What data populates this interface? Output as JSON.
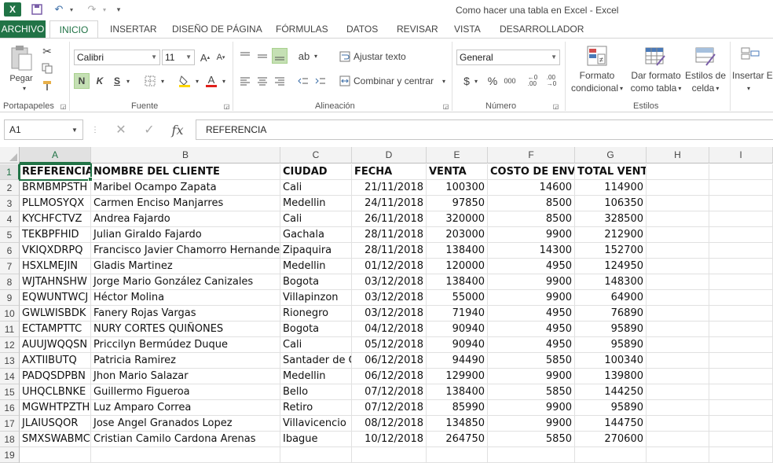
{
  "window": {
    "title": "Como hacer una tabla en Excel - Excel"
  },
  "tabs": [
    "ARCHIVO",
    "INICIO",
    "INSERTAR",
    "DISEÑO DE PÁGINA",
    "FÓRMULAS",
    "DATOS",
    "REVISAR",
    "VISTA",
    "DESARROLLADOR"
  ],
  "ribbon": {
    "paste_label": "Pegar",
    "font_name": "Calibri",
    "font_size": "11",
    "bold": "N",
    "italic": "K",
    "underline": "S",
    "wrap_text": "Ajustar texto",
    "merge_center": "Combinar y centrar",
    "number_format": "General",
    "currency": "$",
    "percent": "%",
    "thousands": "000",
    "cond_format_1": "Formato",
    "cond_format_2": "condicional",
    "format_table_1": "Dar formato",
    "format_table_2": "como tabla",
    "cell_styles_1": "Estilos de",
    "cell_styles_2": "celda",
    "insert": "Insertar",
    "insert_trunc": "E",
    "groups": {
      "clipboard": "Portapapeles",
      "font": "Fuente",
      "alignment": "Alineación",
      "number": "Número",
      "styles": "Estilos"
    }
  },
  "formula_bar": {
    "name_box": "A1",
    "fx": "fx",
    "content": "REFERENCIA"
  },
  "columns": [
    "A",
    "B",
    "C",
    "D",
    "E",
    "F",
    "G",
    "H",
    "I"
  ],
  "rows": [
    [
      "REFERENCIA",
      "NOMBRE DEL CLIENTE",
      "CIUDAD",
      "FECHA",
      "VENTA",
      "COSTO DE ENVIO",
      "TOTAL VENTA"
    ],
    [
      "BRMBMPSTH",
      "Maribel Ocampo Zapata",
      "Cali",
      "21/11/2018",
      "100300",
      "14600",
      "114900"
    ],
    [
      "PLLMOSYQX",
      "Carmen Enciso Manjarres",
      "Medellin",
      "24/11/2018",
      "97850",
      "8500",
      "106350"
    ],
    [
      "KYCHFCTVZ",
      "Andrea Fajardo",
      "Cali",
      "26/11/2018",
      "320000",
      "8500",
      "328500"
    ],
    [
      "TEKBPFHID",
      "Julian Giraldo Fajardo",
      "Gachala",
      "28/11/2018",
      "203000",
      "9900",
      "212900"
    ],
    [
      "VKIQXDRPQ",
      "Francisco Javier Chamorro Hernandez",
      "Zipaquira",
      "28/11/2018",
      "138400",
      "14300",
      "152700"
    ],
    [
      "HSXLMEJIN",
      "Gladis Martinez",
      "Medellin",
      "01/12/2018",
      "120000",
      "4950",
      "124950"
    ],
    [
      "WJTAHNSHW",
      "Jorge Mario González Canizales",
      "Bogota",
      "03/12/2018",
      "138400",
      "9900",
      "148300"
    ],
    [
      "EQWUNTWCJ",
      "Héctor Molina",
      "Villapinzon",
      "03/12/2018",
      "55000",
      "9900",
      "64900"
    ],
    [
      "GWLWISBDK",
      "Fanery Rojas Vargas",
      "Rionegro",
      "03/12/2018",
      "71940",
      "4950",
      "76890"
    ],
    [
      "ECTAMPTTC",
      "NURY CORTES QUIÑONES",
      "Bogota",
      "04/12/2018",
      "90940",
      "4950",
      "95890"
    ],
    [
      "AUUJWQQSN",
      "Priccilyn Bermúdez Duque",
      "Cali",
      "05/12/2018",
      "90940",
      "4950",
      "95890"
    ],
    [
      "AXTIIBUTQ",
      "Patricia Ramirez",
      "Santader de Q",
      "06/12/2018",
      "94490",
      "5850",
      "100340"
    ],
    [
      "PADQSDPBN",
      "Jhon Mario Salazar",
      "Medellin",
      "06/12/2018",
      "129900",
      "9900",
      "139800"
    ],
    [
      "UHQCLBNKE",
      "Guillermo Figueroa",
      "Bello",
      "07/12/2018",
      "138400",
      "5850",
      "144250"
    ],
    [
      "MGWHTPZTH",
      "Luz Amparo Correa",
      "Retiro",
      "07/12/2018",
      "85990",
      "9900",
      "95890"
    ],
    [
      "JLAIUSQOR",
      "Jose Angel Granados Lopez",
      "Villavicencio",
      "08/12/2018",
      "134850",
      "9900",
      "144750"
    ],
    [
      "SMXSWABMC",
      "Cristian Camilo Cardona Arenas",
      "Ibague",
      "10/12/2018",
      "264750",
      "5850",
      "270600"
    ],
    [
      "",
      "",
      "",
      "",
      "",
      "",
      ""
    ]
  ]
}
